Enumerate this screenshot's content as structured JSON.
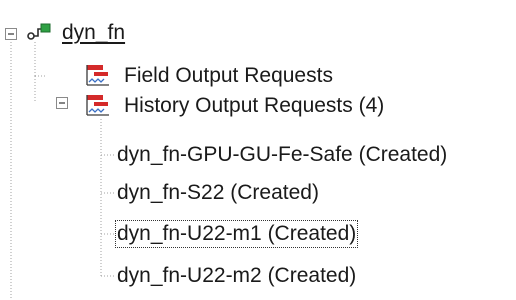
{
  "tree": {
    "root": {
      "label": "dyn_fn",
      "expanded": true,
      "icon": "model-icon"
    },
    "field_output": {
      "label": "Field Output Requests",
      "icon": "field-output-requests-icon"
    },
    "history_output": {
      "label": "History Output Requests (4)",
      "expanded": true,
      "icon": "history-output-requests-icon",
      "children": [
        {
          "label": "dyn_fn-GPU-GU-Fe-Safe (Created)"
        },
        {
          "label": "dyn_fn-S22 (Created)"
        },
        {
          "label": "dyn_fn-U22-m1 (Created)",
          "selected": true
        },
        {
          "label": "dyn_fn-U22-m2 (Created)"
        }
      ]
    }
  },
  "colors": {
    "icon_red": "#d42a2a",
    "icon_green": "#2ea043",
    "icon_blue": "#3a6fc4",
    "tree_lines": "#a0a0a0",
    "text": "#1a1a1a"
  }
}
